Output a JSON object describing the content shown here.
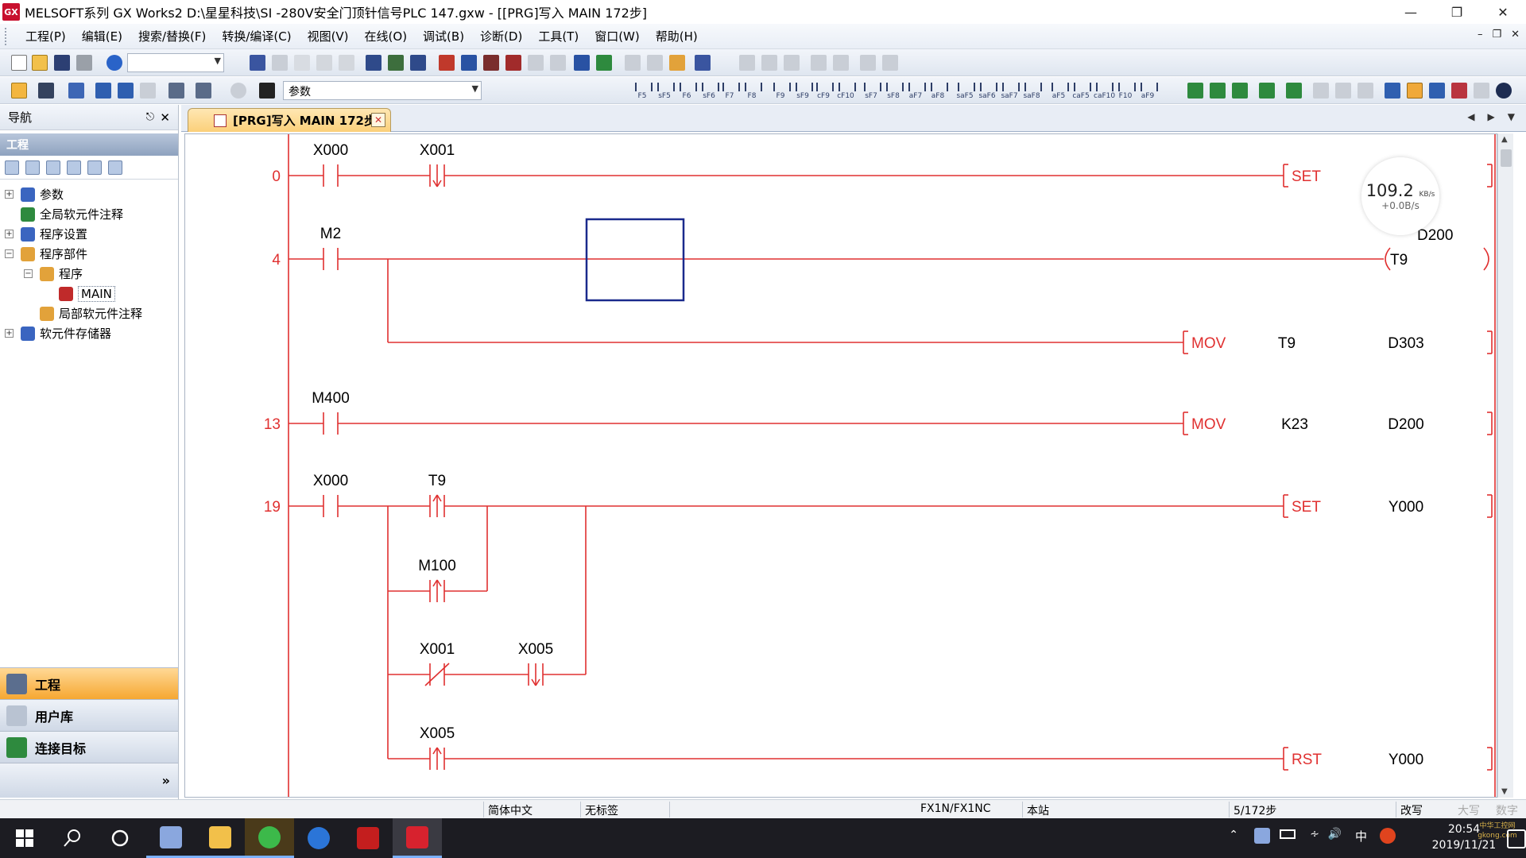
{
  "window": {
    "title": "MELSOFT系列 GX Works2 D:\\星星科技\\SI -280V安全门顶针信号PLC 147.gxw - [[PRG]写入 MAIN 172步]",
    "logo_text": "GX"
  },
  "menu": [
    "工程(P)",
    "编辑(E)",
    "搜索/替换(F)",
    "转换/编译(C)",
    "视图(V)",
    "在线(O)",
    "调试(B)",
    "诊断(D)",
    "工具(T)",
    "窗口(W)",
    "帮助(H)"
  ],
  "toolbar": {
    "combo1_value": "",
    "combo2_value": "参数",
    "fkeys": [
      "F5",
      "sF5",
      "F6",
      "sF6",
      "F7",
      "F8",
      "F9",
      "sF9",
      "cF9",
      "cF10",
      "sF7",
      "sF8",
      "aF7",
      "aF8",
      "saF5",
      "saF6",
      "saF7",
      "saF8",
      "aF5",
      "caF5",
      "caF10",
      "F10",
      "aF9"
    ]
  },
  "nav": {
    "title": "导航",
    "section": "工程",
    "tree": [
      {
        "label": "参数",
        "level": 0,
        "expander": "+"
      },
      {
        "label": "全局软元件注释",
        "level": 0,
        "expander": ""
      },
      {
        "label": "程序设置",
        "level": 0,
        "expander": "+"
      },
      {
        "label": "程序部件",
        "level": 0,
        "expander": "-"
      },
      {
        "label": "程序",
        "level": 1,
        "expander": "-"
      },
      {
        "label": "MAIN",
        "level": 2,
        "expander": ""
      },
      {
        "label": "局部软元件注释",
        "level": 1,
        "expander": ""
      },
      {
        "label": "软元件存储器",
        "level": 0,
        "expander": "+"
      }
    ],
    "buttons": [
      "工程",
      "用户库",
      "连接目标"
    ],
    "more": "»"
  },
  "tab": {
    "label": "[PRG]写入 MAIN 172步"
  },
  "ladder": {
    "steps": [
      {
        "num": "0",
        "contacts": [
          {
            "label": "X000",
            "type": "no"
          },
          {
            "label": "X001",
            "type": "fall"
          }
        ],
        "instr": "SET",
        "ops": []
      },
      {
        "num": "4",
        "contacts": [
          {
            "label": "M2",
            "type": "no"
          }
        ],
        "instr": "",
        "ops": [
          "T9",
          "D200"
        ]
      },
      {
        "num": "13",
        "contacts": [
          {
            "label": "M400",
            "type": "no"
          }
        ],
        "instr": "MOV",
        "ops": [
          "K23",
          "D200"
        ]
      },
      {
        "num": "19",
        "contacts": [
          {
            "label": "X000",
            "type": "no"
          },
          {
            "label": "T9",
            "type": "rise"
          }
        ],
        "instr": "SET",
        "ops": [
          "Y000"
        ]
      }
    ],
    "branch_instr": {
      "instr": "MOV",
      "ops": [
        "T9",
        "D303"
      ]
    },
    "branches": [
      {
        "label": "M100",
        "type": "rise"
      },
      {
        "label": "X001",
        "type": "nc"
      },
      {
        "label": "X005",
        "type": "fall"
      },
      {
        "label": "X005",
        "type": "rise"
      }
    ],
    "last_instr": {
      "instr": "RST",
      "ops": [
        "Y000"
      ]
    }
  },
  "net_widget": {
    "speed": "109.2",
    "unit": "KB/s",
    "sub": "+0.0B/s"
  },
  "status": {
    "lang": "简体中文",
    "label": "无标签",
    "cpu": "FX1N/FX1NC",
    "station": "本站",
    "step": "5/172步",
    "mode": "改写",
    "caps": "大写",
    "num": "数字"
  },
  "taskbar": {
    "time": "20:54",
    "date": "2019/11/21",
    "ime": "中",
    "watermark": "中华工控网 gkong.com"
  },
  "colors": {
    "ladder": "#e03030",
    "cursor": "#1a2a8c",
    "nav_active": "#f6a731",
    "taskbar": "#1c1c22"
  }
}
